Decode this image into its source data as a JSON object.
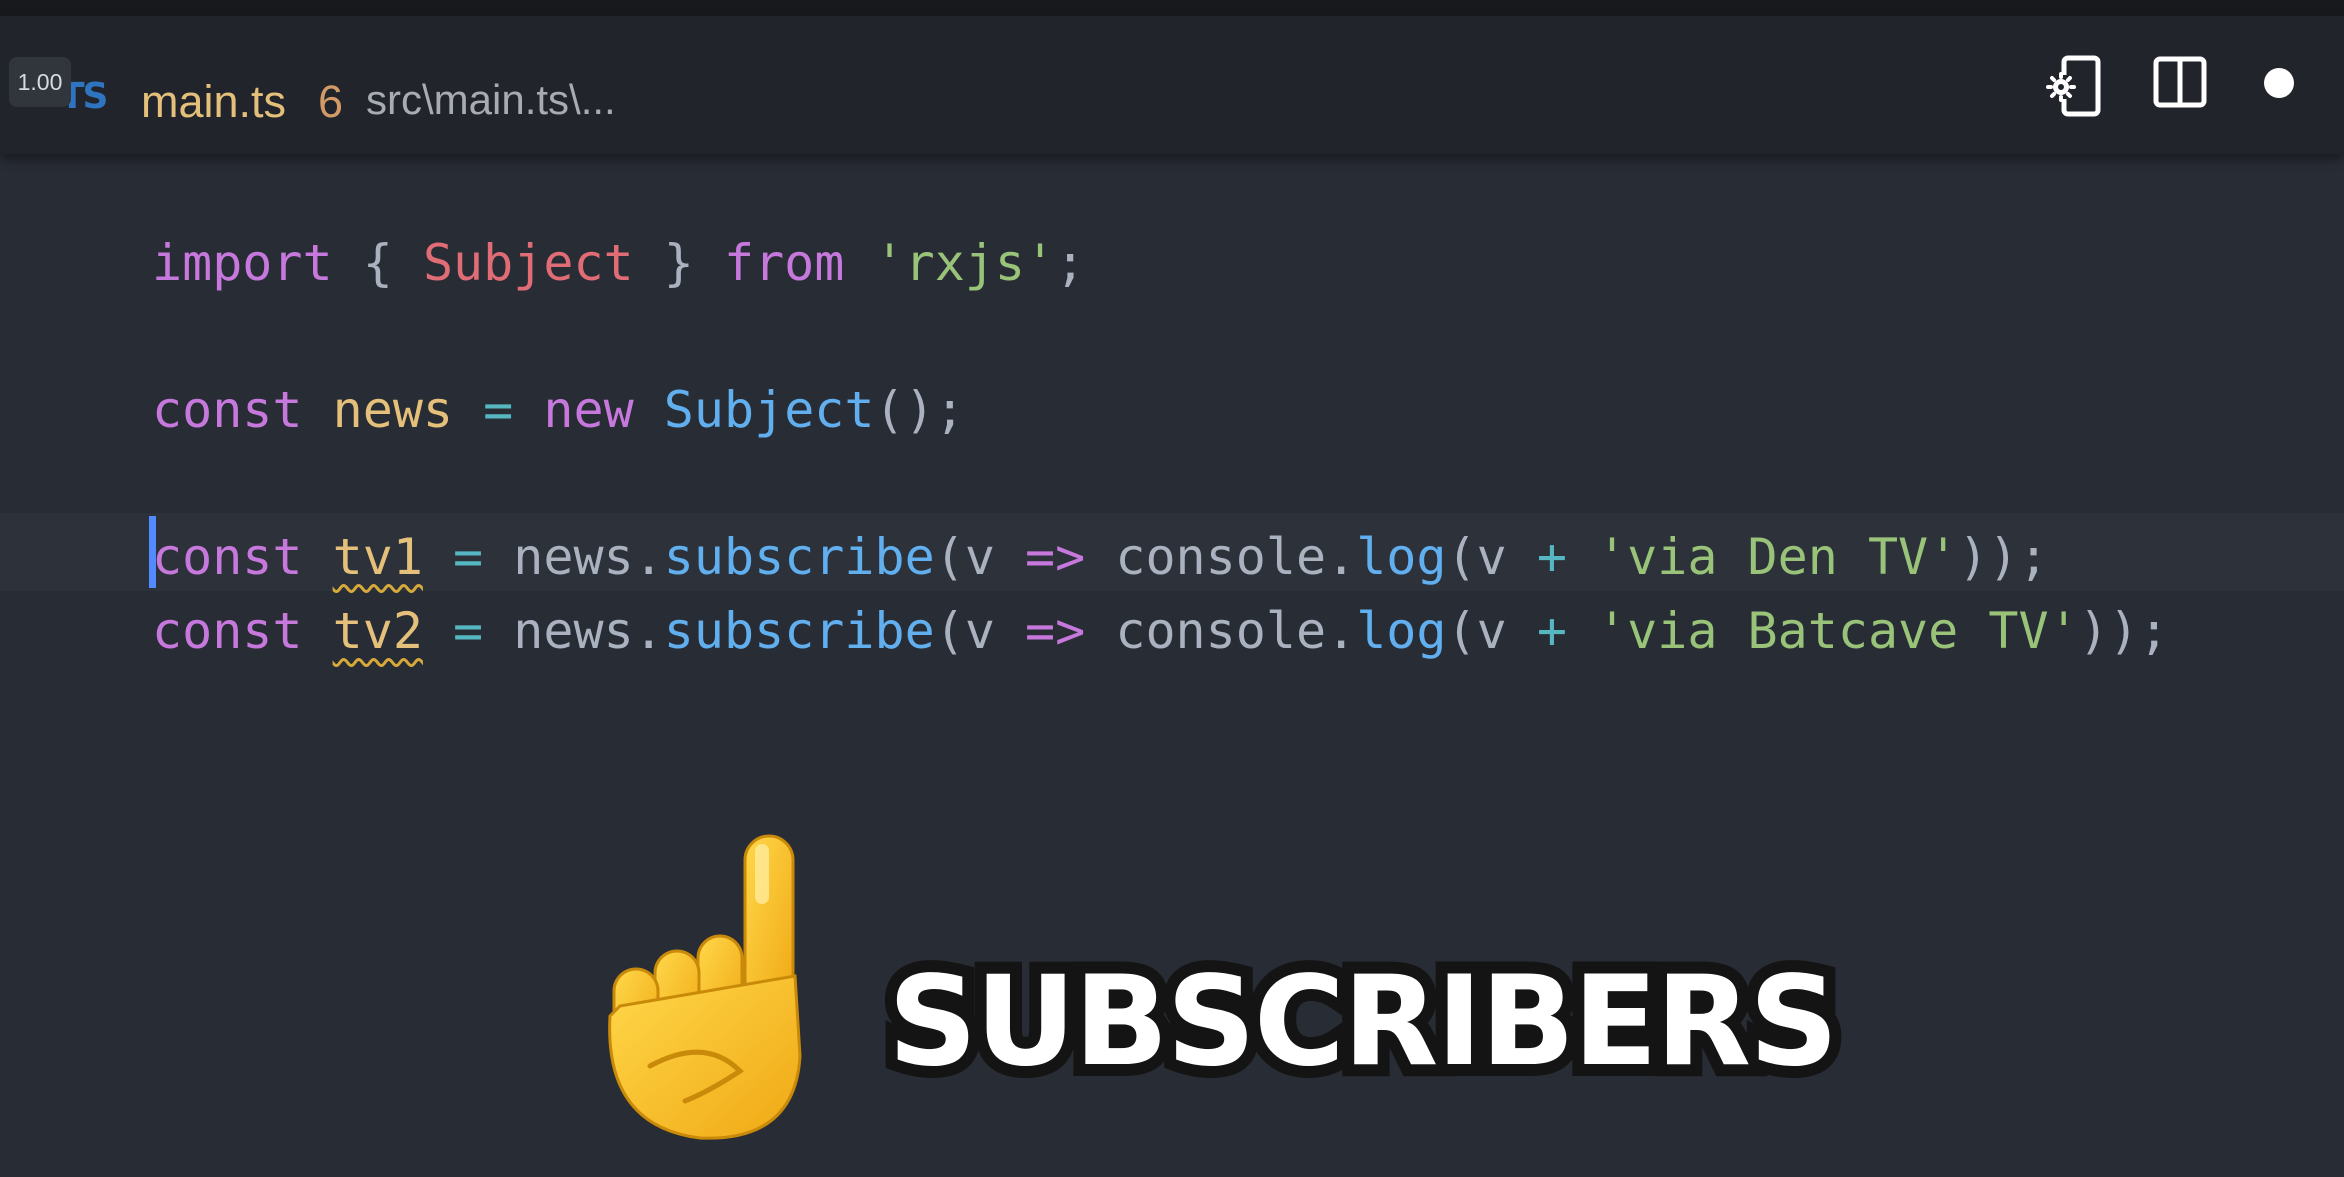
{
  "player": {
    "speed_label": "1.00"
  },
  "tab": {
    "language_icon": "TS",
    "filename": "main.ts",
    "problem_count": "6",
    "path": "src\\main.ts\\..."
  },
  "tab_actions": [
    {
      "icon": "phone-settings-icon"
    },
    {
      "icon": "split-editor-icon"
    },
    {
      "icon": "unsaved-dot-icon"
    }
  ],
  "code": {
    "line1": {
      "kw_import": "import",
      "brace_open": " { ",
      "cls_subject": "Subject",
      "brace_close": " } ",
      "kw_from": "from",
      "space": " ",
      "str": "'rxjs'",
      "semi": ";"
    },
    "line2": {
      "kw_const": "const",
      "var": "news",
      "eq": "=",
      "kw_new": "new",
      "fn": "Subject",
      "tail": "();"
    },
    "line3": {
      "kw_const": "const",
      "var": "tv1",
      "eq": "=",
      "obj": "news.",
      "fn": "subscribe",
      "paren": "(v ",
      "arrow": "=>",
      "obj2": " console.",
      "fn2": "log",
      "paren2": "(v ",
      "plus": "+",
      "str": "'via Den TV'",
      "tail": "));"
    },
    "line4": {
      "kw_const": "const",
      "var": "tv2",
      "eq": "=",
      "obj": "news.",
      "fn": "subscribe",
      "paren": "(v ",
      "arrow": "=>",
      "obj2": " console.",
      "fn2": "log",
      "paren2": "(v ",
      "plus": "+",
      "str": "'via Batcave TV'",
      "tail": "));"
    }
  },
  "overlay": {
    "caption": "SUBSCRIBERS",
    "emoji": "pointing-up-hand"
  },
  "colors": {
    "editor_bg": "#282c34",
    "tabbar_bg": "#21252b",
    "keyword": "#c678dd",
    "class": "#e06c75",
    "string": "#98c379",
    "function": "#61afef",
    "variable": "#e5c07b",
    "cursor": "#528bff"
  }
}
